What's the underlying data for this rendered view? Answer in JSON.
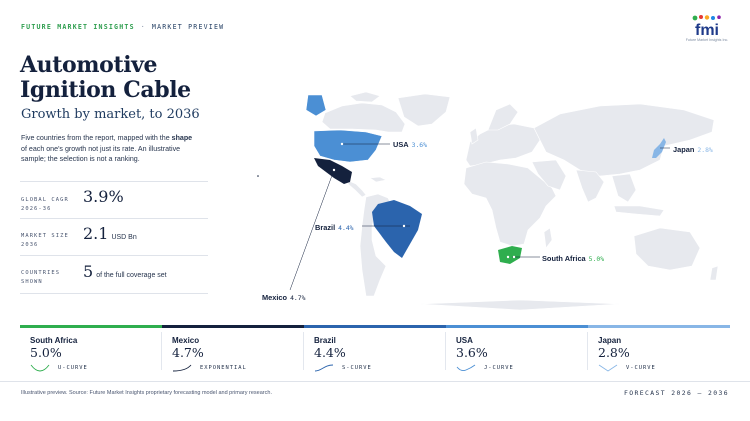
{
  "brand": {
    "name": "FUTURE MARKET INSIGHTS",
    "separator": "·",
    "section": "MARKET PREVIEW",
    "logo_text": "fmi",
    "logo_sub": "Future Market Insights Inc."
  },
  "title": {
    "line1": "Automotive",
    "line2": "Ignition Cable",
    "subtitle": "Growth by market, to 2036"
  },
  "description": {
    "part1": "Five countries from the report, mapped with the ",
    "emphasis": "shape",
    "part2": " of each one's growth not just its rate. An illustrative sample; the selection is not a ranking."
  },
  "stats": [
    {
      "label_line1": "GLOBAL CAGR",
      "label_line2": "2026-36",
      "value": "3.9%",
      "unit": ""
    },
    {
      "label_line1": "MARKET SIZE",
      "label_line2": "2036",
      "value": "2.1",
      "unit": "USD Bn"
    },
    {
      "label_line1": "COUNTRIES",
      "label_line2": "SHOWN",
      "value": "5",
      "unit": "of the full coverage set"
    }
  ],
  "chart_data": {
    "type": "map",
    "series": [
      {
        "country": "South Africa",
        "cagr": "5.0%",
        "value": 5.0,
        "curve": "U-CURVE",
        "color": "#2fae4e"
      },
      {
        "country": "Mexico",
        "cagr": "4.7%",
        "value": 4.7,
        "curve": "EXPONENTIAL",
        "color": "#14213d"
      },
      {
        "country": "Brazil",
        "cagr": "4.4%",
        "value": 4.4,
        "curve": "S-CURVE",
        "color": "#2b64ad"
      },
      {
        "country": "USA",
        "cagr": "3.6%",
        "value": 3.6,
        "curve": "J-CURVE",
        "color": "#4b8fd4"
      },
      {
        "country": "Japan",
        "cagr": "2.8%",
        "value": 2.8,
        "curve": "V-CURVE",
        "color": "#88b6e6"
      }
    ]
  },
  "colors": {
    "land": "#e7e9ee",
    "navy": "#14213d",
    "green": "#2fae4e"
  },
  "footer": {
    "source": "Illustrative preview. Source: Future Market Insights proprietary forecasting model and primary research.",
    "forecast": "FORECAST 2026 – 2036"
  }
}
